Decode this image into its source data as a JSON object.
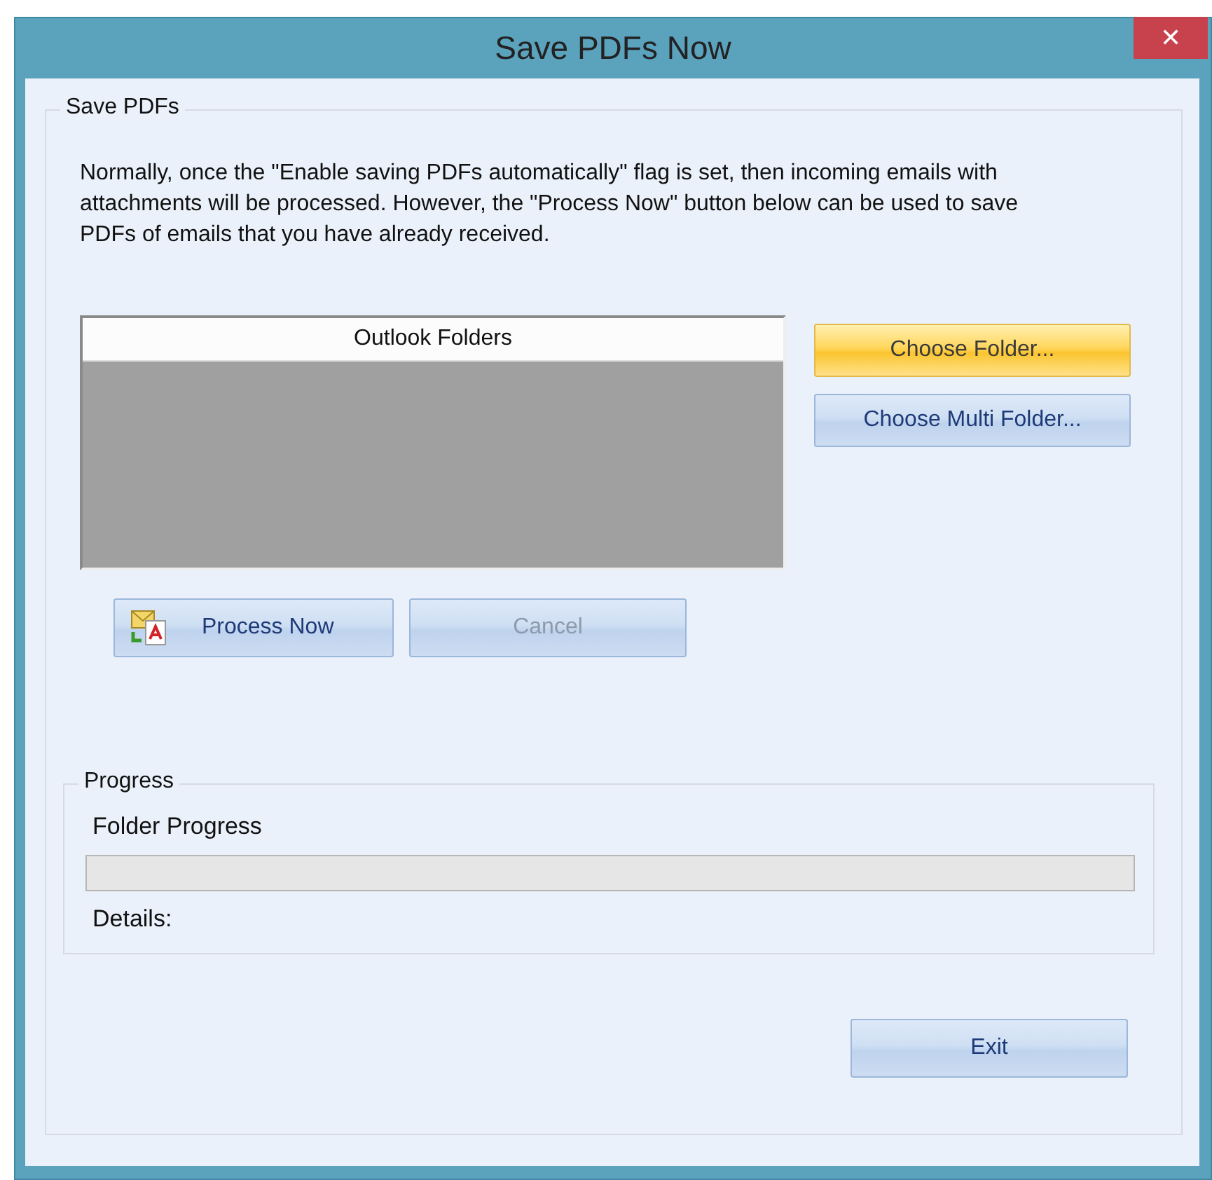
{
  "window": {
    "title": "Save PDFs Now",
    "close": "✕"
  },
  "save_group": {
    "legend": "Save PDFs",
    "description": "Normally, once the \"Enable saving PDFs automatically\" flag is set, then incoming emails with attachments will be processed.  However, the \"Process Now\" button below can be used to save PDFs of emails that you have already received.",
    "folder_list": {
      "header": "Outlook Folders"
    },
    "side_buttons": [
      {
        "label": "Choose Folder...",
        "highlighted": true
      },
      {
        "label": "Choose Multi Folder...",
        "highlighted": false
      }
    ],
    "action_buttons": [
      {
        "label": "Process Now",
        "icon": true,
        "disabled": false
      },
      {
        "label": "Cancel",
        "icon": false,
        "disabled": true
      }
    ]
  },
  "progress_group": {
    "legend": "Progress",
    "folder_label": "Folder Progress",
    "level": 0,
    "details_label": "Details:"
  },
  "exit_button": {
    "label": "Exit",
    "disabled": false
  }
}
